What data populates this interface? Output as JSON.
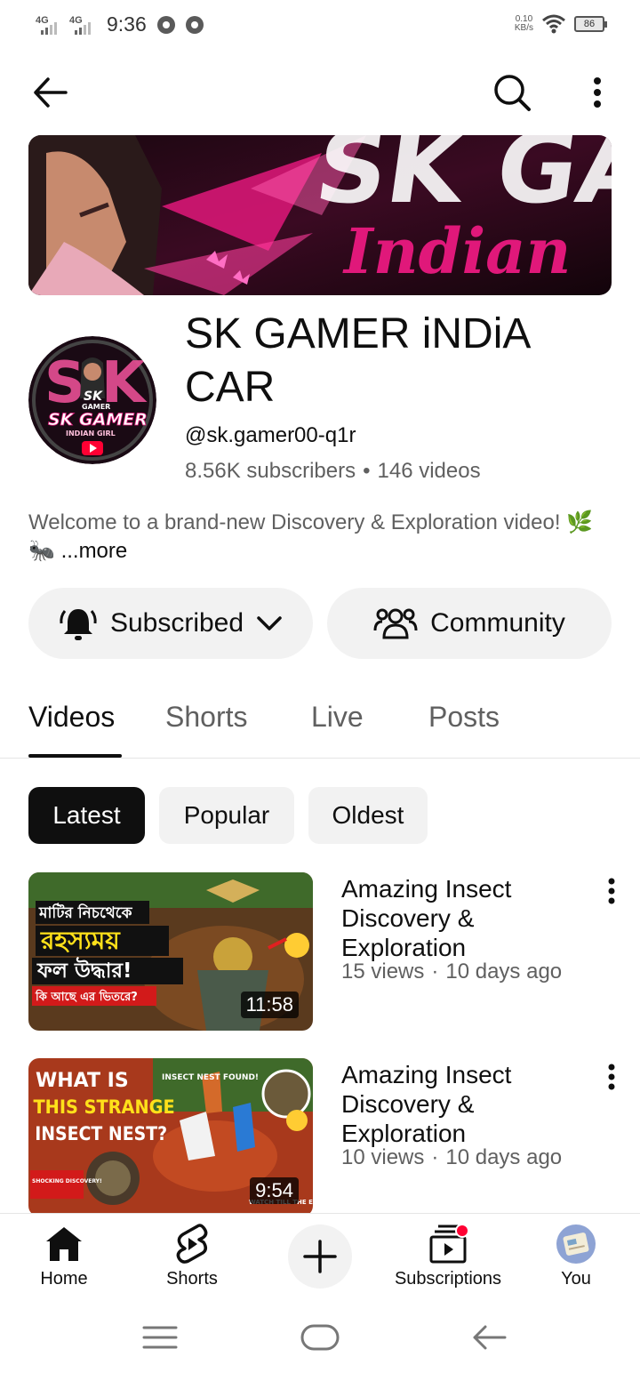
{
  "status_bar": {
    "network1": "4G",
    "network2": "4G",
    "time": "9:36",
    "speed_value": "0.10",
    "speed_unit": "KB/s",
    "battery": "86"
  },
  "app_bar": {
    "back_icon": "arrow-left-icon",
    "search_icon": "search-icon",
    "menu_icon": "more-vert-icon"
  },
  "channel": {
    "name": "SK GAMER iNDiA CAR",
    "handle": "@sk.gamer00-q1r",
    "subscribers": "8.56K subscribers",
    "videos": "146 videos",
    "description": "Welcome to a brand-new Discovery & Exploration video! 🌿🐜",
    "more_label": "...more"
  },
  "banner": {
    "big_text": "SK GAI",
    "script_text": "Indian"
  },
  "avatar": {
    "line1": "SK",
    "line2": "GAMER",
    "line3": "SK GAMER",
    "line4": "INDIAN GIRL"
  },
  "actions": {
    "subscribed_label": "Subscribed",
    "community_label": "Community"
  },
  "tabs": [
    "Videos",
    "Shorts",
    "Live",
    "Posts"
  ],
  "chips": [
    "Latest",
    "Popular",
    "Oldest"
  ],
  "videos": [
    {
      "title": "Amazing Insect Discovery & Exploration",
      "views": "15 views",
      "age": "10 days ago",
      "duration": "11:58",
      "thumb_text1": "মাটির নিচথেকে",
      "thumb_text2": "রহস্যময়",
      "thumb_text3": "ফল উদ্ধার!",
      "thumb_text4": "কি আছে এর ভিতরে?"
    },
    {
      "title": "Amazing Insect Discovery & Exploration",
      "views": "10 views",
      "age": "10 days ago",
      "duration": "9:54",
      "thumb_text1": "WHAT IS",
      "thumb_text2": "THIS STRANGE",
      "thumb_text3": "INSECT NEST?",
      "thumb_text4": "SHOCKING DISCOVERY!",
      "thumb_text5": "INSECT NEST FOUND!",
      "thumb_text6": "WATCH TILL THE END!"
    }
  ],
  "bottom_nav": {
    "home": "Home",
    "shorts": "Shorts",
    "subscriptions": "Subscriptions",
    "you": "You"
  },
  "colors": {
    "text_primary": "#0f0f0f",
    "text_secondary": "#606060",
    "chip_bg": "#f2f2f2",
    "banner_accent": "#e0187a",
    "notification_dot": "#ff0033"
  }
}
